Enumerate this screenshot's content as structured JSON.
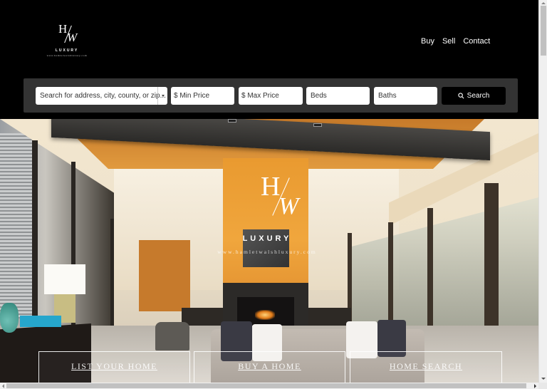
{
  "brand": {
    "monogram_top": "H",
    "monogram_bottom": "W",
    "word": "LUXURY",
    "url": "www.hamletwalshluxury.com"
  },
  "nav": {
    "items": [
      {
        "label": "Buy"
      },
      {
        "label": "Sell"
      },
      {
        "label": "Contact"
      }
    ]
  },
  "search": {
    "address_placeholder": "Search for address, city, county, or zip...",
    "min_price_placeholder": "$ Min Price",
    "max_price_placeholder": "$ Max Price",
    "beds_placeholder": "Beds",
    "baths_placeholder": "Baths",
    "button_label": "Search",
    "button_icon": "search-icon"
  },
  "hero": {
    "logo_top": "H",
    "logo_bottom": "W",
    "logo_word": "LUXURY",
    "logo_url": "www.hamletwalshluxury.com",
    "image_description": "Modern luxury living room with orange accent wall and fireplace"
  },
  "cta": {
    "list_home": "LIST YOUR HOME",
    "buy_home": "BUY A HOME",
    "home_search": "HOME SEARCH"
  },
  "colors": {
    "header_bg": "#000000",
    "searchbar_bg": "#333333",
    "search_button_bg": "#000000",
    "accent_orange": "#F0A63D"
  }
}
